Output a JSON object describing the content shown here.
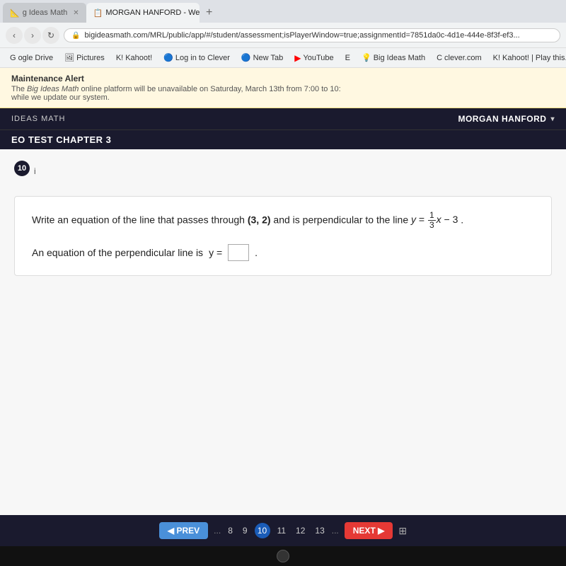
{
  "browser": {
    "tabs": [
      {
        "id": "tab1",
        "label": "g Ideas Math",
        "active": false,
        "icon": "📐"
      },
      {
        "id": "tab2",
        "label": "MORGAN HANFORD - Weekly As",
        "active": true,
        "icon": "📋"
      },
      {
        "id": "tab-add",
        "label": "+"
      }
    ],
    "url": "bigideasmath.com/MRL/public/app/#/student/assessment;isPlayerWindow=true;assignmentId=7851da0c-4d1e-444e-8f3f-ef3...",
    "bookmarks": [
      {
        "label": "ogle Drive",
        "icon": "G"
      },
      {
        "label": "Pictures",
        "icon": "🖼"
      },
      {
        "label": "Kahoot!",
        "icon": "K!"
      },
      {
        "label": "Log in to Clever",
        "icon": "🔵"
      },
      {
        "label": "New Tab",
        "icon": "🔵"
      },
      {
        "label": "YouTube",
        "icon": "▶",
        "isYoutube": true
      },
      {
        "label": "E",
        "icon": "E"
      },
      {
        "label": "Big Ideas Math",
        "icon": "💡"
      },
      {
        "label": "clever.com",
        "icon": "C"
      },
      {
        "label": "Kahoot! | Play this...",
        "icon": "K!"
      }
    ]
  },
  "maintenance": {
    "title": "Maintenance Alert",
    "body_prefix": "The ",
    "body_brand": "Big Ideas Math",
    "body_suffix": " online platform will be unavailable on Saturday, March 13th from 7:00 to 10:",
    "body_extra": "while we update our system."
  },
  "header": {
    "logo": "IDEAS MATH",
    "user": "MORGAN HANFORD",
    "chevron": "▾"
  },
  "chapter": {
    "title": "EO TEST CHAPTER 3"
  },
  "question": {
    "number": "10",
    "info": "i",
    "text_before": "Write an equation of the line that passes through",
    "point": "(3, 2)",
    "text_middle": "and is perpendicular to the line",
    "equation_y": "y =",
    "fraction_num": "1",
    "fraction_den": "3",
    "equation_rest": "x − 3",
    "period": ".",
    "answer_prefix": "An equation of the perpendicular line is",
    "answer_eq": "y =",
    "answer_placeholder": ""
  },
  "pagination": {
    "prev_label": "◀  PREV",
    "next_label": "NEXT  ▶",
    "dots": "...",
    "pages": [
      "8",
      "9",
      "10",
      "11",
      "12",
      "13"
    ],
    "active_page": "10"
  }
}
